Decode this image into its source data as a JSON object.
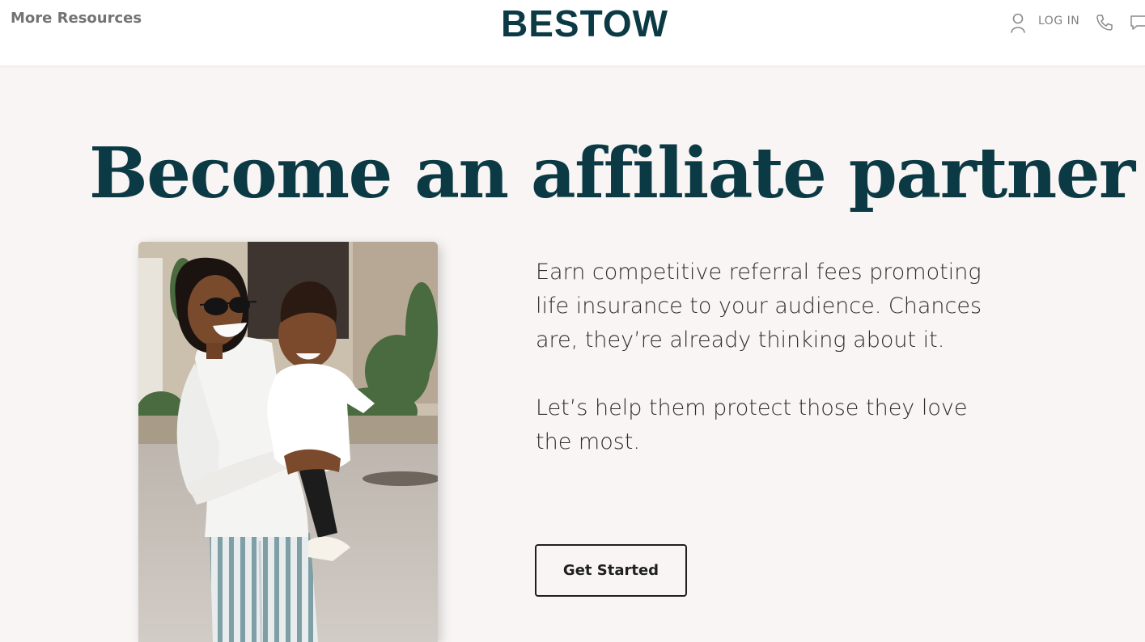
{
  "header": {
    "more_resources": "More Resources",
    "logo": "BESTOW",
    "login": "LOG IN",
    "icons": [
      "user-icon",
      "phone-icon",
      "chat-icon"
    ]
  },
  "hero": {
    "headline": "Become an affiliate partner",
    "paragraph_1": "Earn competitive referral fees promoting life insurance to your audience. Chances are, they’re already thinking about it.",
    "paragraph_2": "Let’s help them protect those they love the most.",
    "cta_label": "Get Started"
  },
  "colors": {
    "brand_dark": "#0b3a45",
    "page_background": "#f8f5f4",
    "header_background": "#ffffff",
    "body_text": "#2e2e2e",
    "nav_text": "#737373"
  }
}
